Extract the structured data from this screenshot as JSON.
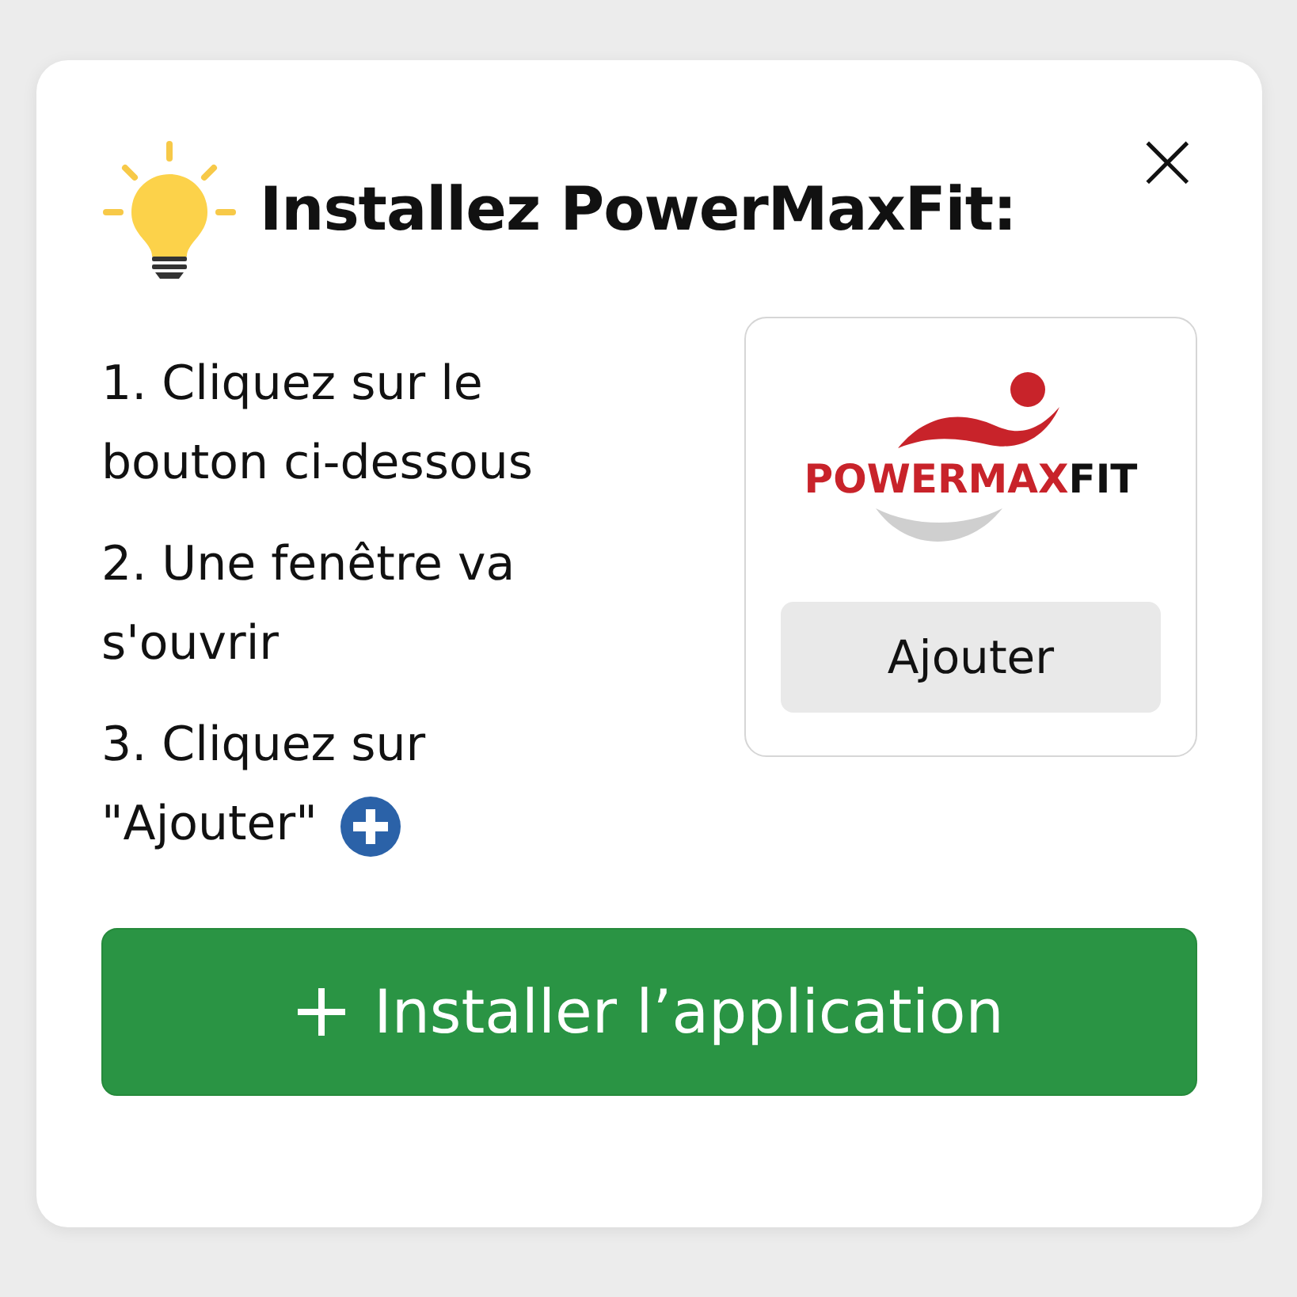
{
  "dialog": {
    "title": "Installez PowerMaxFit:",
    "close": "×",
    "steps": [
      {
        "text": "1. Cliquez sur le bouton ci-dessous",
        "plus_icon": false
      },
      {
        "text": "2. Une fenêtre va s'ouvrir",
        "plus_icon": false
      },
      {
        "text": "3. Cliquez sur \"Ajouter\"",
        "plus_icon": true
      }
    ],
    "preview": {
      "logo_main": "POWERMAX",
      "logo_accent": "FIT",
      "button": "Ajouter"
    },
    "install_button": "Installer l’application"
  }
}
